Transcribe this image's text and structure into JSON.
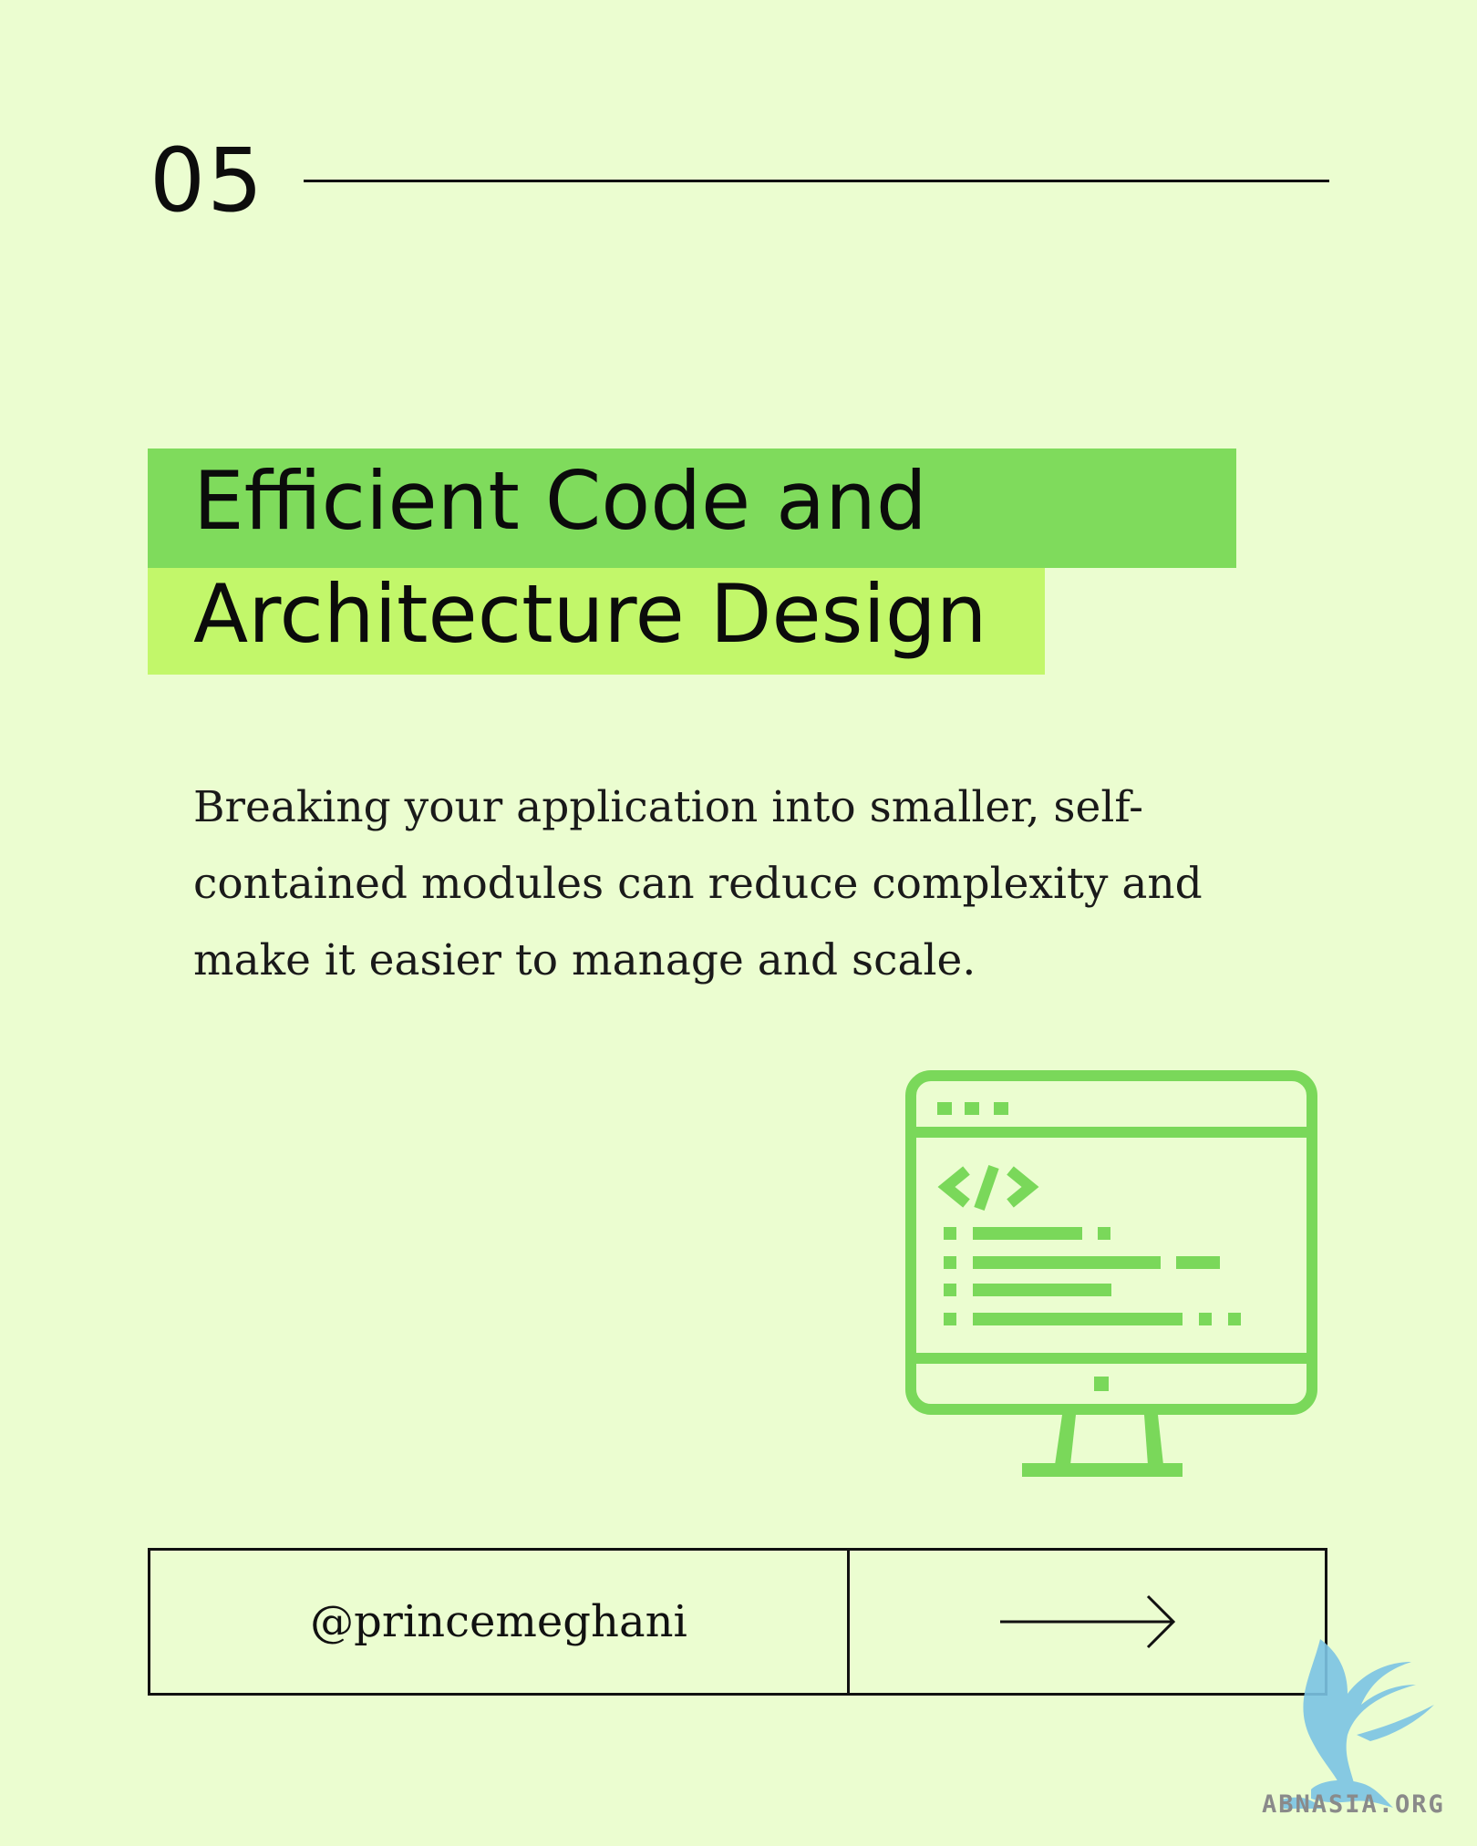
{
  "slide": {
    "number": "05"
  },
  "title": {
    "line1": "Efficient Code and",
    "line2": "Architecture Design"
  },
  "body": {
    "lines": [
      "Breaking your application into smaller, self-",
      "contained modules can reduce complexity and",
      "make it easier to manage and scale."
    ]
  },
  "illustration": {
    "icon": "code-monitor-icon",
    "code_glyph": "</>"
  },
  "footer": {
    "handle": "@princemeghani",
    "next_icon": "arrow-right-icon"
  },
  "watermark": {
    "text": "ABNASIA.ORG",
    "icon": "griffin-logo-icon"
  },
  "colors": {
    "background": "#ebfdd0",
    "title_highlight_1": "#7fdb5c",
    "title_highlight_2": "#c2f76a",
    "icon_green": "#7ad85a",
    "watermark_blue": "#7cc4e4",
    "text": "#111111"
  }
}
